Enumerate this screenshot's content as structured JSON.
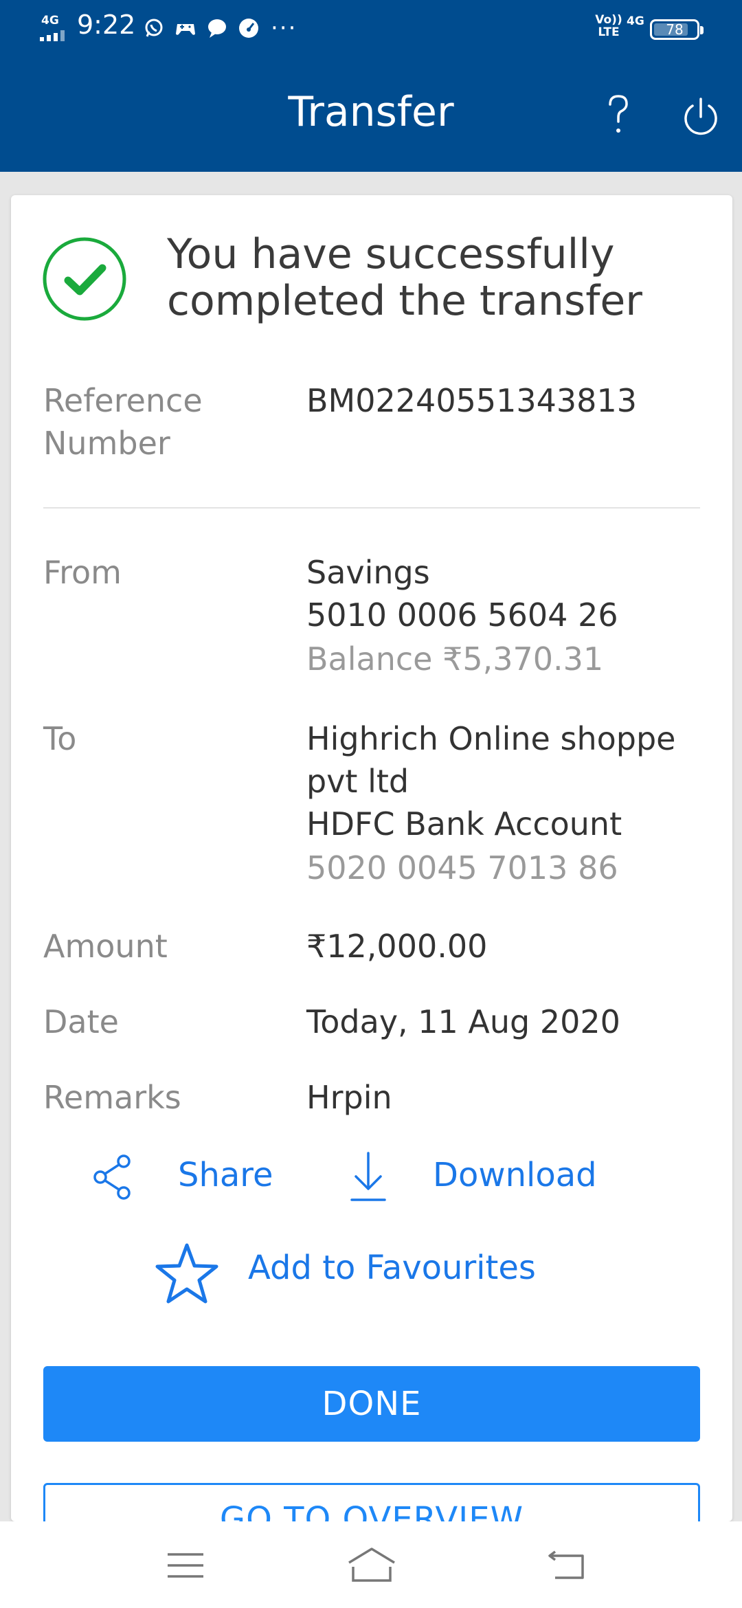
{
  "status_bar": {
    "network_left": "4G",
    "time": "9:22",
    "more": "···",
    "volte": "Vo)) LTE",
    "network_right": "4G",
    "battery": "78"
  },
  "app_bar": {
    "title": "Transfer"
  },
  "success": {
    "message": "You have successfully completed the transfer"
  },
  "details": {
    "reference_label": "Reference Number",
    "reference_value": "BM02240551343813",
    "from_label": "From",
    "from_account_type": "Savings",
    "from_account_number": "5010 0006 5604 26",
    "from_balance": "Balance ₹5,370.31",
    "to_label": "To",
    "to_name": "Highrich Online shoppe pvt ltd",
    "to_bank": "HDFC Bank Account",
    "to_account_number": "5020 0045 7013 86",
    "amount_label": "Amount",
    "amount_value": "₹12,000.00",
    "date_label": "Date",
    "date_value": "Today, 11 Aug 2020",
    "remarks_label": "Remarks",
    "remarks_value": "Hrpin"
  },
  "actions": {
    "share_label": "Share",
    "download_label": "Download",
    "favourites_label": "Add to Favourites"
  },
  "buttons": {
    "done_label": "DONE",
    "overview_label": "GO TO OVERVIEW"
  },
  "colors": {
    "app_bar_bg": "#004c8f",
    "accent_blue": "#1e88f7",
    "success_green": "#1aaa3c"
  },
  "icons": {
    "status": [
      "signal-icon",
      "whatsapp-icon",
      "game-icon",
      "chat-icon",
      "speedometer-icon"
    ],
    "app_bar": [
      "help-icon",
      "power-icon"
    ],
    "success": "check-circle-icon",
    "actions": [
      "share-icon",
      "download-icon",
      "star-icon"
    ],
    "nav": [
      "menu-icon",
      "home-icon",
      "back-icon"
    ]
  }
}
